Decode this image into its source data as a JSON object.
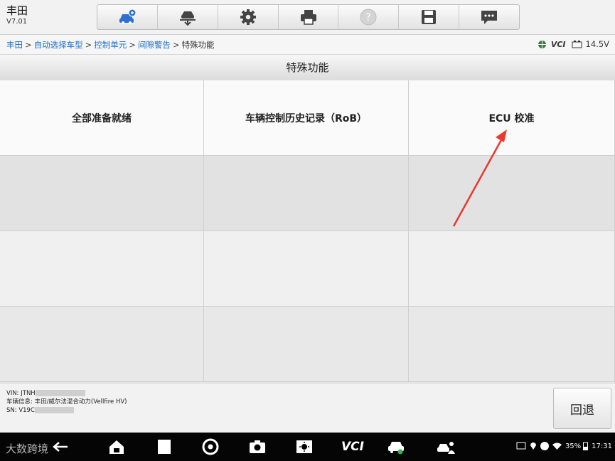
{
  "app": {
    "title": "丰田",
    "version": "V7.01"
  },
  "toolbar": {
    "icons": [
      "car-home-icon",
      "car-lift-icon",
      "gear-icon",
      "printer-icon",
      "help-icon",
      "save-icon",
      "message-icon"
    ]
  },
  "breadcrumb": {
    "items": [
      "丰田",
      "自动选择车型",
      "控制单元",
      "间隙警告"
    ],
    "separator": ">",
    "current": "特殊功能"
  },
  "status": {
    "vci_label": "VCI",
    "voltage": "14.5V"
  },
  "page_title": "特殊功能",
  "functions": [
    "全部准备就绪",
    "车辆控制历史记录（RoB）",
    "ECU 校准"
  ],
  "vehicle_info": {
    "vin_label": "VIN: JTNH",
    "info_line": "车辆信息: 丰田/威尔法混合动力(Vellfire HV)",
    "sn_label": "SN: V19C"
  },
  "back_button": "回退",
  "system_bar": {
    "watermark": "大数跨境",
    "battery": "35%",
    "time": "17:31",
    "vci_label": "VCI"
  },
  "colors": {
    "link": "#1a6fc9",
    "arrow": "#e8392d",
    "accent_icon": "#2f6fd0"
  }
}
